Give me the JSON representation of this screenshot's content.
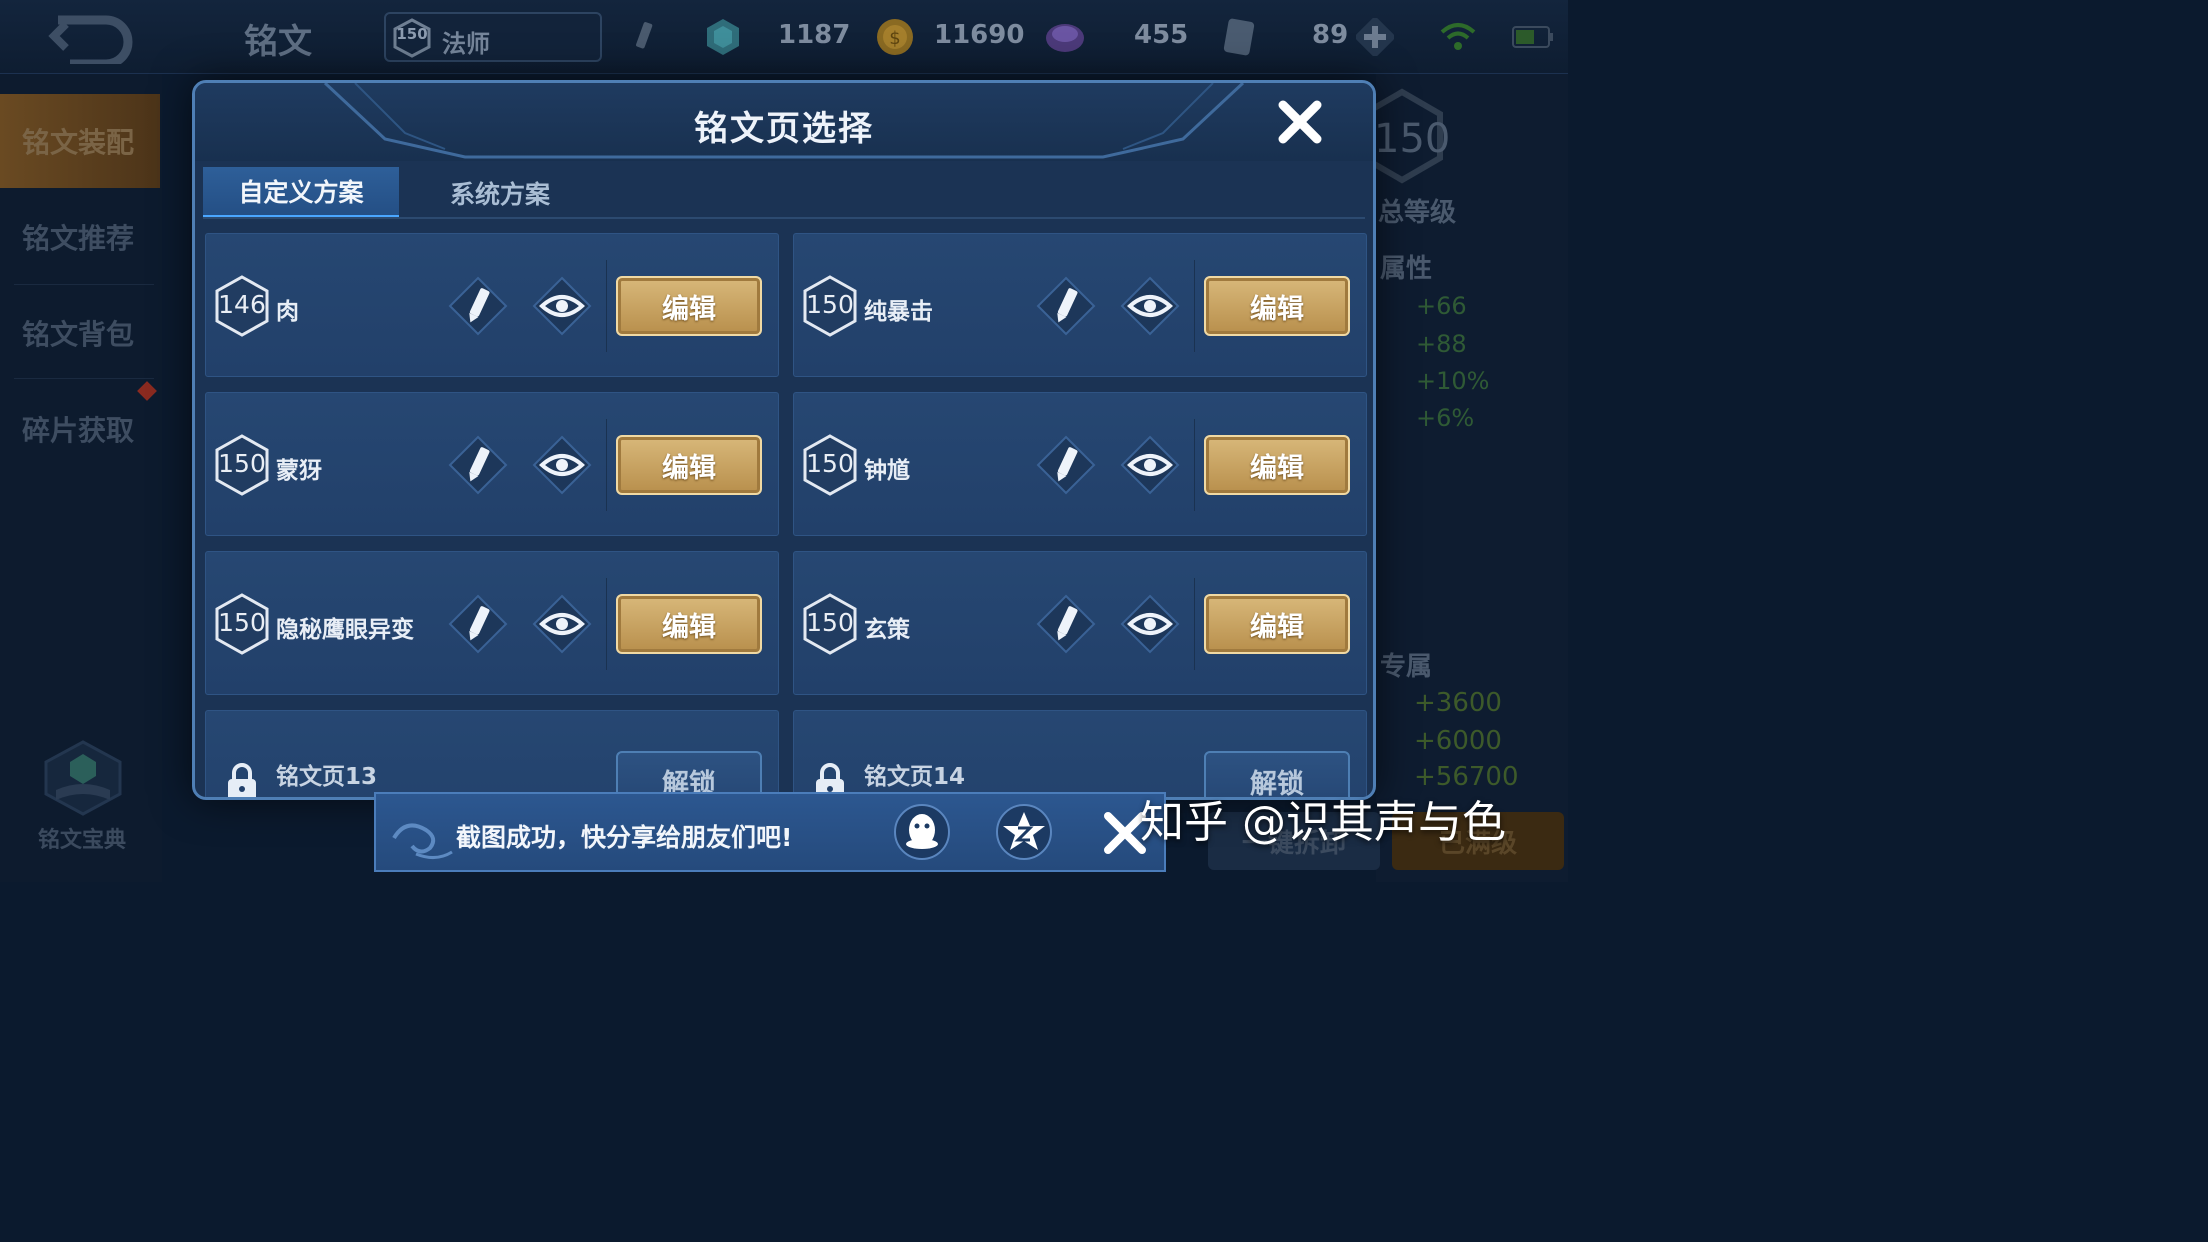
{
  "topbar": {
    "screen_title": "铭文",
    "role_level": "150",
    "role_name": "法师",
    "currencies": [
      {
        "icon": "crystal-icon",
        "value": "1187"
      },
      {
        "icon": "gold-coin-icon",
        "value": "11690"
      },
      {
        "icon": "diamond-icon",
        "value": "455"
      },
      {
        "icon": "voucher-icon",
        "value": "89"
      }
    ]
  },
  "sidebar": {
    "items": [
      {
        "label": "铭文装配"
      },
      {
        "label": "铭文推荐"
      },
      {
        "label": "铭文背包"
      },
      {
        "label": "碎片获取"
      }
    ],
    "codex_label": "铭文宝典"
  },
  "right_panel": {
    "total_level": "150",
    "total_level_label": "总等级",
    "attr_label": "属性",
    "bonuses": [
      "+66",
      "+88",
      "+10%",
      "+6%"
    ],
    "exclusive_label": "专属",
    "exclusive_bonuses": [
      "+3600",
      "+6000",
      "+56700"
    ],
    "one_key_label": "一键拆卸",
    "max_label": "已满级"
  },
  "modal": {
    "title": "铭文页选择",
    "tabs": [
      {
        "label": "自定义方案",
        "active": true
      },
      {
        "label": "系统方案",
        "active": false
      }
    ],
    "edit_label": "编辑",
    "unlock_label": "解锁",
    "pages": [
      {
        "level": "146",
        "name": "肉"
      },
      {
        "level": "150",
        "name": "纯暴击"
      },
      {
        "level": "150",
        "name": "蒙犽"
      },
      {
        "level": "150",
        "name": "钟馗"
      },
      {
        "level": "150",
        "name": "隐秘鹰眼异变"
      },
      {
        "level": "150",
        "name": "玄策"
      }
    ],
    "locked_pages": [
      {
        "name": "铭文页13"
      },
      {
        "name": "铭文页14"
      }
    ]
  },
  "toast": {
    "message": "截图成功，快分享给朋友们吧!"
  },
  "watermark": "知乎 @识其声与色",
  "colors": {
    "modal_bg": "#1b3354",
    "modal_border": "#4f7fb5",
    "card_bg": "#264772",
    "gold_button": "#c9a562",
    "active_tab": "#2e5f99"
  }
}
